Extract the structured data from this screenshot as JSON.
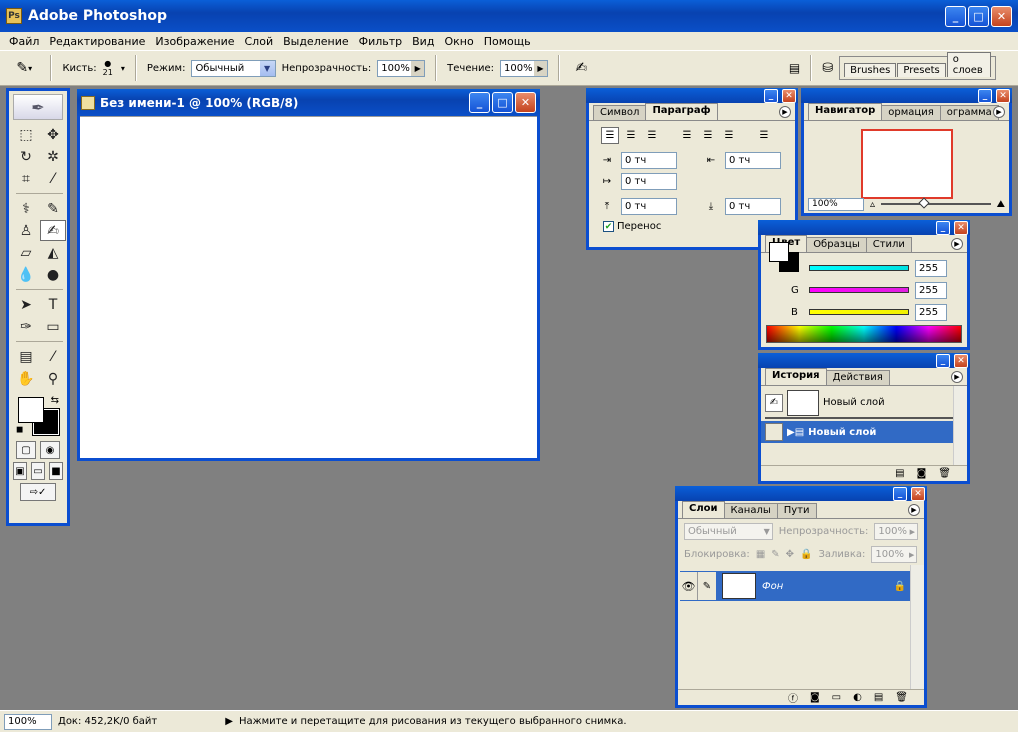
{
  "app": {
    "title": "Adobe Photoshop"
  },
  "menu": [
    "Файл",
    "Редактирование",
    "Изображение",
    "Слой",
    "Выделение",
    "Фильтр",
    "Вид",
    "Окно",
    "Помощь"
  ],
  "options": {
    "brush_label": "Кисть:",
    "brush_size": "21",
    "mode_label": "Режим:",
    "mode_value": "Обычный",
    "opacity_label": "Непрозрачность:",
    "opacity_value": "100%",
    "flow_label": "Течение:",
    "flow_value": "100%",
    "well_tabs": [
      "Brushes",
      "Presets",
      "о слоев"
    ]
  },
  "document": {
    "title": "Без имени-1 @ 100% (RGB/8)"
  },
  "paragraph_panel": {
    "tabs": [
      "Символ",
      "Параграф"
    ],
    "indent_left": "0 тч",
    "indent_right": "0 тч",
    "indent_first": "0 тч",
    "space_before": "0 тч",
    "space_after": "0 тч",
    "hyphenate_label": "Перенос"
  },
  "navigator_panel": {
    "tabs": [
      "Навигатор",
      "ормация",
      "ограмма"
    ],
    "zoom": "100%"
  },
  "color_panel": {
    "tabs": [
      "Цвет",
      "Образцы",
      "Стили"
    ],
    "channels": [
      {
        "label": "R",
        "value": "255",
        "color": "#00e0e0"
      },
      {
        "label": "G",
        "value": "255",
        "color": "#e020e0"
      },
      {
        "label": "B",
        "value": "255",
        "color": "#f0f000"
      }
    ]
  },
  "history_panel": {
    "tabs": [
      "История",
      "Действия"
    ],
    "snapshot_label": "Новый слой",
    "items": [
      "Новый слой"
    ]
  },
  "layers_panel": {
    "tabs": [
      "Слои",
      "Каналы",
      "Пути"
    ],
    "blend_mode": "Обычный",
    "opacity_label": "Непрозрачность:",
    "opacity_value": "100%",
    "lock_label": "Блокировка:",
    "fill_label": "Заливка:",
    "fill_value": "100%",
    "layers": [
      {
        "name": "Фон"
      }
    ]
  },
  "status": {
    "zoom": "100%",
    "doc_info": "Док: 452,2K/0 байт",
    "hint": "Нажмите и перетащите для рисования из текущего выбранного снимка."
  }
}
